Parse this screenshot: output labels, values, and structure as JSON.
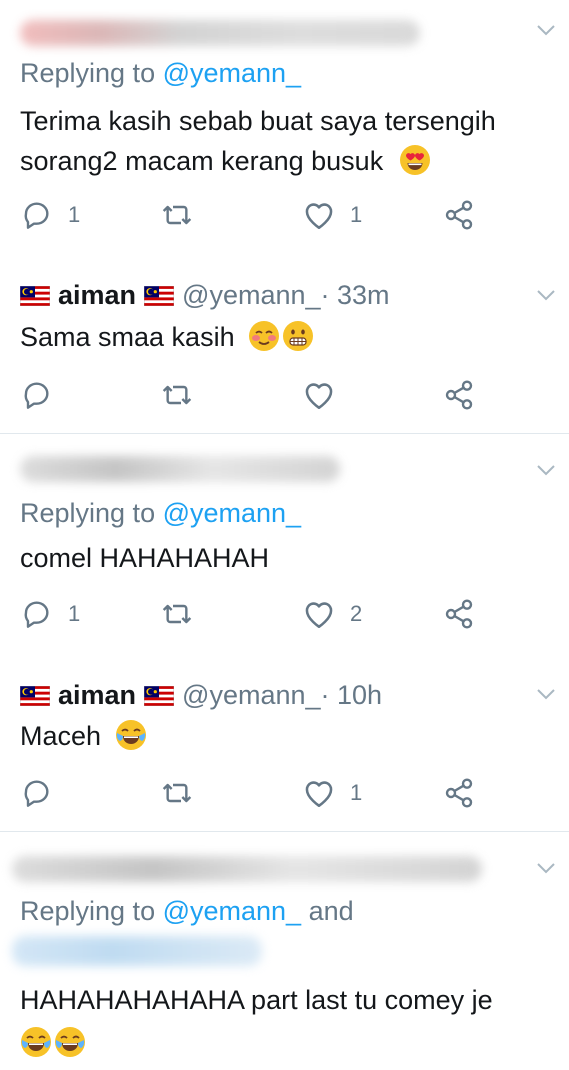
{
  "colors": {
    "link": "#1da1f2",
    "secondary": "#657786",
    "text": "#14171a",
    "divider": "#e1e8ed"
  },
  "icons": {
    "reply": "reply-icon",
    "retweet": "retweet-icon",
    "like": "heart-icon",
    "share": "share-icon",
    "more": "chevron-down-icon",
    "flag": "malaysia-flag-icon"
  },
  "tweets": [
    {
      "reply_prefix": "Replying to ",
      "reply_mention": "@yemann_",
      "text_line1": "Terima kasih sebab buat saya tersengih",
      "text_line2": "sorang2 macam kerang busuk",
      "emoji": "heart-eyes-emoji",
      "reply_count": "1",
      "like_count": "1"
    },
    {
      "name": "aiman",
      "handle": "@yemann_",
      "time": " · 33m",
      "text": "Sama smaa kasih",
      "emoji": [
        "blushing-emoji",
        "grimacing-emoji"
      ],
      "reply_count": "",
      "like_count": ""
    },
    {
      "reply_prefix": "Replying to ",
      "reply_mention": "@yemann_",
      "text": "comel HAHAHAHAH",
      "reply_count": "1",
      "like_count": "2"
    },
    {
      "name": "aiman",
      "handle": "@yemann_",
      "time": " · 10h",
      "text": "Maceh",
      "emoji": [
        "tears-of-joy-emoji"
      ],
      "reply_count": "",
      "like_count": "1"
    },
    {
      "reply_prefix": "Replying to ",
      "reply_mention": "@yemann_",
      "reply_suffix": " and",
      "text": "HAHAHAHAHAHA part last tu comey je",
      "emoji": [
        "tears-of-joy-emoji",
        "tears-of-joy-emoji"
      ]
    }
  ]
}
